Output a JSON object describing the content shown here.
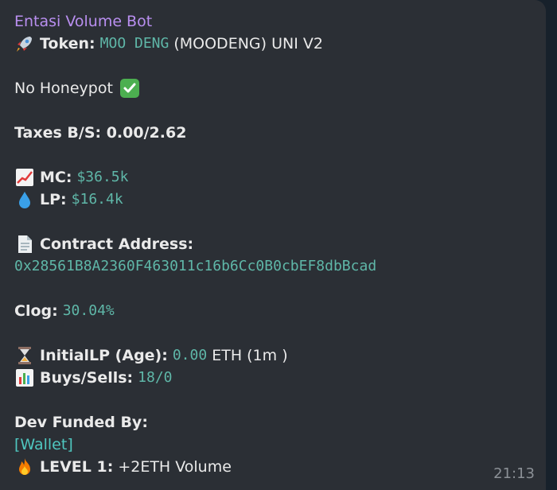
{
  "message": {
    "sender": "Entasi Volume Bot",
    "token_label": "Token:",
    "token_name": "MOO DENG",
    "token_rest": "(MOODENG) UNI V2",
    "honeypot": "No Honeypot",
    "taxes": "Taxes B/S: 0.00/2.62",
    "mc_label": "MC:",
    "mc_value": "$36.5k",
    "lp_label": "LP:",
    "lp_value": "$16.4k",
    "contract_label": "Contract Address:",
    "contract_address": "0x28561B8A2360F463011c16b6Cc0B0cbEF8dbBcad",
    "clog_label": "Clog:",
    "clog_value": "30.04%",
    "initial_lp_label": "InitialLP (Age):",
    "initial_lp_value": "0.00",
    "initial_lp_rest": "ETH (1m )",
    "buys_sells_label": "Buys/Sells:",
    "buys_sells_value": "18/0",
    "dev_funded_label": "Dev Funded By:",
    "wallet_link": "[Wallet]",
    "level_label": "LEVEL 1:",
    "level_rest": "+2ETH Volume",
    "time": "21:13"
  },
  "icons": {
    "token": "rocket-icon",
    "honeypot": "check-mark-icon",
    "mc": "chart-increasing-icon",
    "lp": "droplet-icon",
    "contract": "page-icon",
    "initial_lp": "hourglass-icon",
    "buys_sells": "bar-chart-icon",
    "level": "fire-icon"
  }
}
